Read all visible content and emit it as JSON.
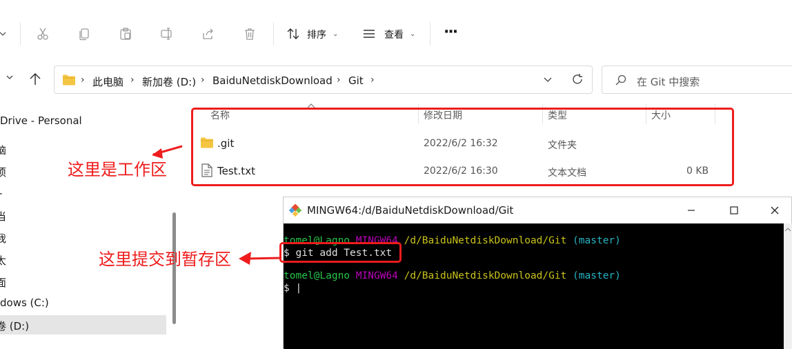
{
  "toolbar": {
    "sort_label": "排序",
    "view_label": "查看",
    "more_label": "···"
  },
  "address_bar": {
    "crumbs": [
      "此电脑",
      "新加卷 (D:)",
      "BaiduNetdiskDownload",
      "Git"
    ]
  },
  "search": {
    "placeholder": "在 Git 中搜索"
  },
  "sidebar": {
    "items": [
      {
        "label": "Drive - Personal"
      },
      {
        "label": "脑"
      },
      {
        "label": "项"
      },
      {
        "label": "-"
      },
      {
        "label": "当"
      },
      {
        "label": "我"
      },
      {
        "label": "太"
      },
      {
        "label": "面"
      },
      {
        "label": "dows (C:)"
      },
      {
        "label": "卷 (D:)"
      }
    ]
  },
  "file_list": {
    "columns": [
      "名称",
      "修改日期",
      "类型",
      "大小"
    ],
    "rows": [
      {
        "name": ".git",
        "date": "2022/6/2 16:32",
        "type": "文件夹",
        "size": "",
        "icon": "folder-icon"
      },
      {
        "name": "Test.txt",
        "date": "2022/6/2 16:30",
        "type": "文本文档",
        "size": "0 KB",
        "icon": "text-file-icon"
      }
    ]
  },
  "annotations": {
    "workspace": "这里是工作区",
    "staging": "这里提交到暂存区"
  },
  "terminal": {
    "title": "MINGW64:/d/BaiduNetdiskDownload/Git",
    "prompt1": {
      "user": "tomel@Lagno",
      "env": "MINGW64",
      "path": "/d/BaiduNetdiskDownload/Git",
      "branch": "(master)"
    },
    "command": "$ git add Test.txt",
    "prompt2": {
      "user": "tomel@Lagno",
      "env": "MINGW64",
      "path": "/d/BaiduNetdiskDownload/Git",
      "branch": "(master)"
    },
    "cursor_line": "$ |"
  },
  "colors": {
    "annotation_red": "#ee1c1c",
    "folder_yellow": "#f4c543",
    "terminal_bg": "#000000",
    "selection_gray": "#e5e5e5"
  }
}
